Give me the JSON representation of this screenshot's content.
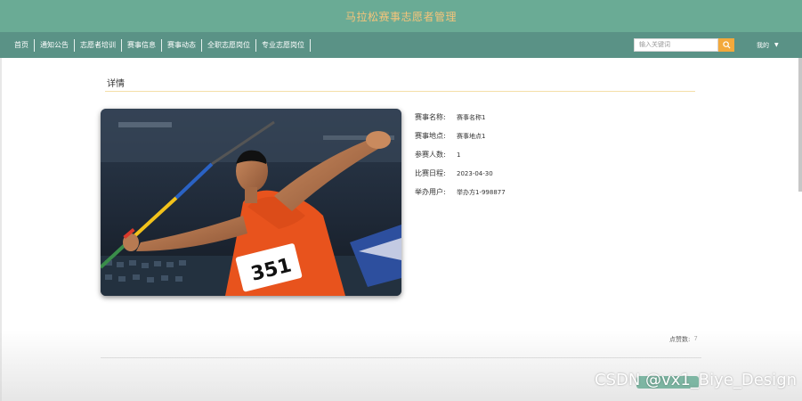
{
  "header": {
    "site_title": "马拉松赛事志愿者管理"
  },
  "nav": {
    "items": [
      {
        "label": "首页"
      },
      {
        "label": "通知公告"
      },
      {
        "label": "志愿者培训"
      },
      {
        "label": "赛事信息"
      },
      {
        "label": "赛事动态"
      },
      {
        "label": "全职志愿岗位"
      },
      {
        "label": "专业志愿岗位"
      }
    ],
    "search_placeholder": "输入关键词",
    "search_icon": "search-icon",
    "user_menu_label": "我的",
    "user_menu_icon": "caret-down-icon"
  },
  "detail": {
    "title": "详情",
    "fields": [
      {
        "label": "赛事名称:",
        "value": "赛事名称1"
      },
      {
        "label": "赛事地点:",
        "value": "赛事地点1"
      },
      {
        "label": "参赛人数:",
        "value": "1"
      },
      {
        "label": "比赛日程:",
        "value": "2023-04-30"
      },
      {
        "label": "举办用户:",
        "value": "举办方1-998877"
      }
    ],
    "clicks_label": "点赞数:",
    "clicks_value": "7",
    "bib_number": "351"
  },
  "watermark": "CSDN @vx1_Biye_Design",
  "colors": {
    "header": "#6aab95",
    "nav": "#5a9286",
    "title_text": "#f6c47a",
    "search_button": "#f3a93b",
    "divider": "#f4dfa8"
  }
}
